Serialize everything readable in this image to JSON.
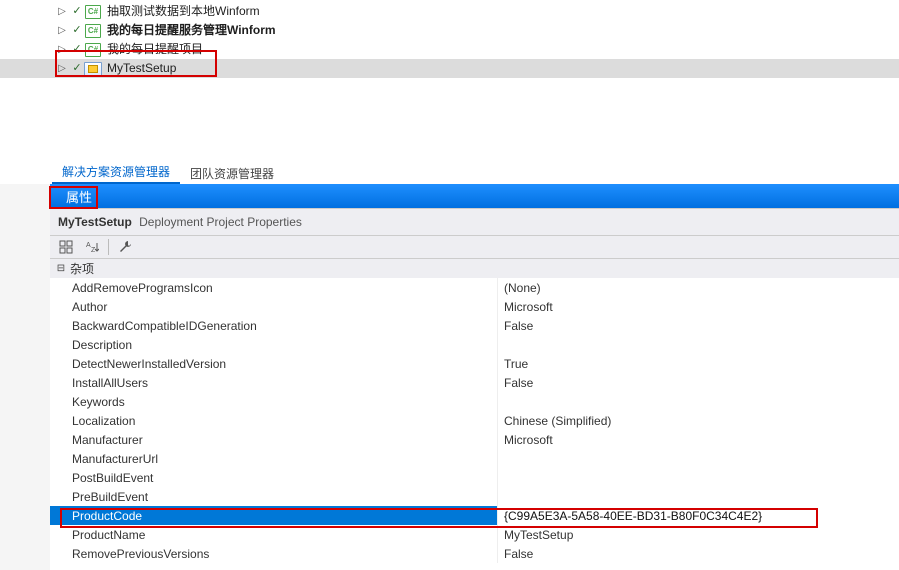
{
  "explorer": {
    "items": [
      {
        "label": "抽取测试数据到本地Winform",
        "bold": false,
        "iconType": "cs"
      },
      {
        "label": "我的每日提醒服务管理Winform",
        "bold": true,
        "iconType": "cs"
      },
      {
        "label": "我的每日提醒项目",
        "bold": false,
        "iconType": "cs"
      },
      {
        "label": "MyTestSetup",
        "bold": false,
        "iconType": "setup",
        "selected": true
      }
    ],
    "tabs": [
      {
        "label": "解决方案资源管理器",
        "active": true
      },
      {
        "label": "团队资源管理器",
        "active": false
      }
    ]
  },
  "properties": {
    "panelTitle": "属性",
    "header": {
      "name": "MyTestSetup",
      "suffix": "Deployment Project Properties"
    },
    "category": "杂项",
    "rows": [
      {
        "key": "AddRemoveProgramsIcon",
        "value": "(None)"
      },
      {
        "key": "Author",
        "value": "Microsoft"
      },
      {
        "key": "BackwardCompatibleIDGeneration",
        "value": "False"
      },
      {
        "key": "Description",
        "value": ""
      },
      {
        "key": "DetectNewerInstalledVersion",
        "value": "True"
      },
      {
        "key": "InstallAllUsers",
        "value": "False"
      },
      {
        "key": "Keywords",
        "value": ""
      },
      {
        "key": "Localization",
        "value": "Chinese (Simplified)"
      },
      {
        "key": "Manufacturer",
        "value": "Microsoft"
      },
      {
        "key": "ManufacturerUrl",
        "value": ""
      },
      {
        "key": "PostBuildEvent",
        "value": ""
      },
      {
        "key": "PreBuildEvent",
        "value": ""
      },
      {
        "key": "ProductCode",
        "value": "{C99A5E3A-5A58-40EE-BD31-B80F0C34C4E2}",
        "selected": true
      },
      {
        "key": "ProductName",
        "value": "MyTestSetup"
      },
      {
        "key": "RemovePreviousVersions",
        "value": "False"
      }
    ]
  }
}
